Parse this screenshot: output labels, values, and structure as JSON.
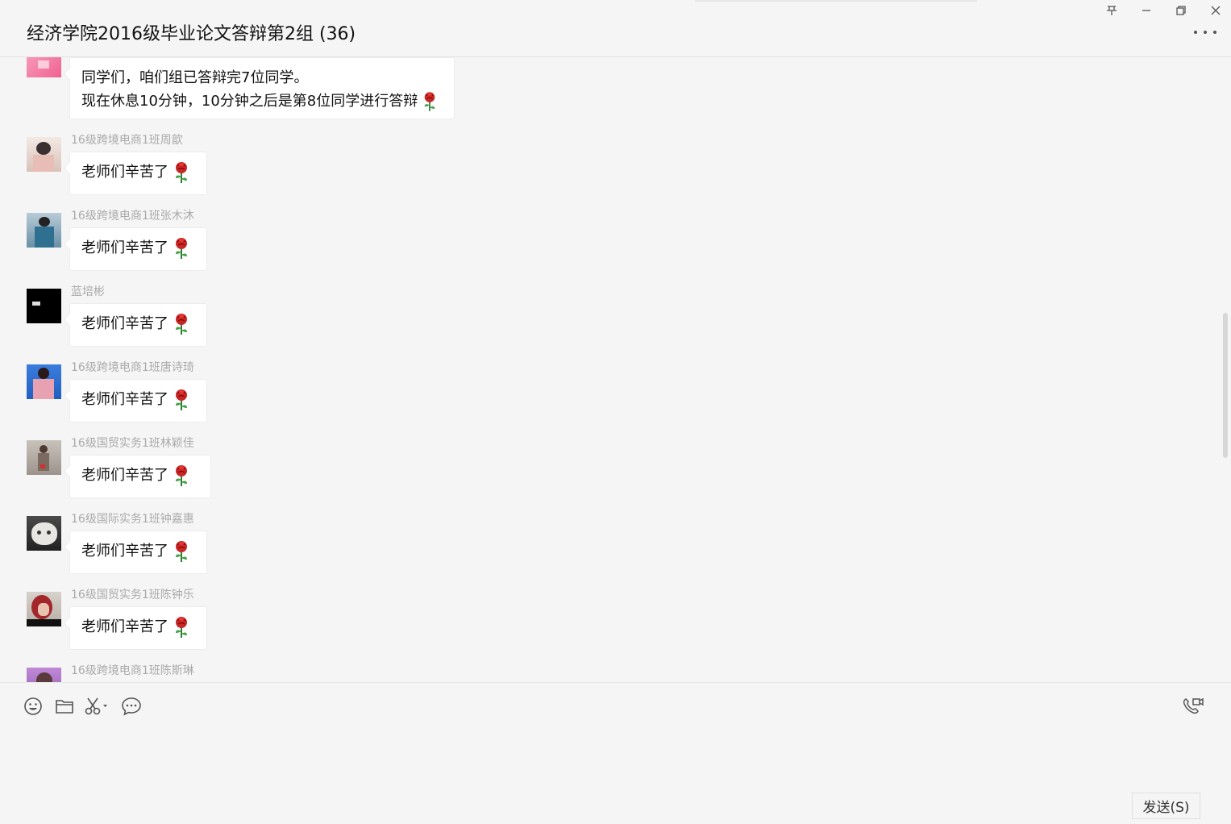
{
  "header": {
    "title": "经济学院2016级毕业论文答辩第2组 (36)",
    "window_controls": [
      "pin-icon",
      "minimize-icon",
      "restore-icon",
      "close-icon"
    ]
  },
  "messages": [
    {
      "sender": "",
      "lines": [
        "同学们，咱们组已答辩完7位同学。",
        "现在休息10分钟，10分钟之后是第8位同学进行答辩"
      ],
      "emoji": "rose"
    },
    {
      "sender": "16级跨境电商1班周歆",
      "text": "老师们辛苦了",
      "emoji": "rose"
    },
    {
      "sender": "16级跨境电商1班张木沐",
      "text": "老师们辛苦了",
      "emoji": "rose"
    },
    {
      "sender": "蓝培彬",
      "text": "老师们辛苦了",
      "emoji": "rose"
    },
    {
      "sender": "16级跨境电商1班唐诗琦",
      "text": "老师们辛苦了",
      "emoji": "rose"
    },
    {
      "sender": "16级国贸实务1班林颖佳",
      "text": "老师们辛苦了",
      "emoji": "rose"
    },
    {
      "sender": "16级国际实务1班钟嘉惠",
      "text": "老师们辛苦了",
      "emoji": "rose"
    },
    {
      "sender": "16级国贸实务1班陈钟乐",
      "text": "老师们辛苦了",
      "emoji": "rose"
    },
    {
      "sender": "16级跨境电商1班陈斯琳",
      "text": "",
      "emoji": ""
    }
  ],
  "toolbar": {
    "icons": [
      "emoji-icon",
      "folder-icon",
      "scissors-icon",
      "chat-history-icon",
      "video-call-icon"
    ]
  },
  "send_button": {
    "label": "发送(S)"
  },
  "colors": {
    "background": "#f5f5f5",
    "bubble": "#ffffff",
    "sender_text": "#aaaaaa"
  }
}
